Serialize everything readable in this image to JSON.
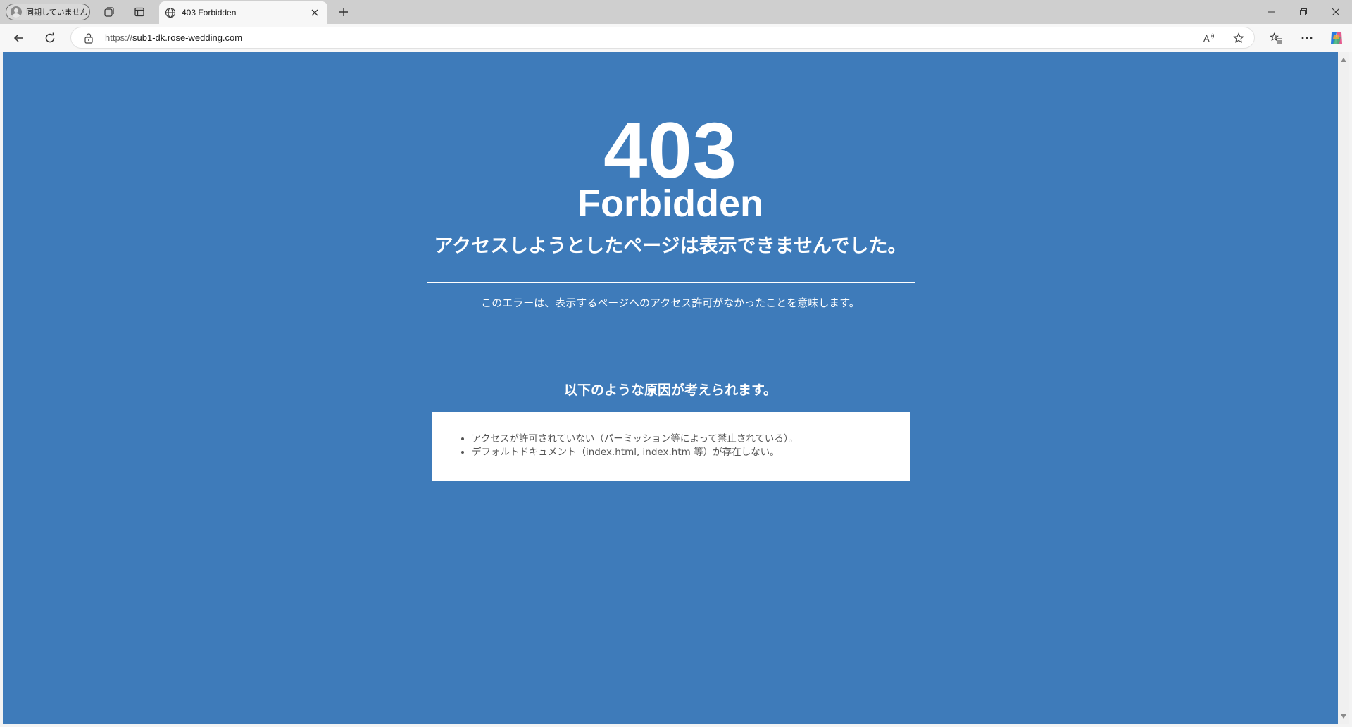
{
  "browser": {
    "profile_label": "同期していません",
    "tab_title": "403 Forbidden",
    "url_scheme": "https://",
    "url_host": "sub1-dk.rose-wedding.com"
  },
  "page": {
    "background_color": "#3e7bba",
    "code": "403",
    "status": "Forbidden",
    "headline": "アクセスしようとしたページは表示できませんでした。",
    "explanation": "このエラーは、表示するページへのアクセス許可がなかったことを意味します。",
    "causes_title": "以下のような原因が考えられます。",
    "causes": [
      "アクセスが許可されていない（パーミッション等によって禁止されている）。",
      "デフォルトドキュメント（index.html, index.htm 等）が存在しない。"
    ]
  },
  "icons": {
    "tabbar": [
      "avatar-icon",
      "collections-icon",
      "tab-actions-icon",
      "globe-icon",
      "close-icon",
      "new-tab-icon",
      "minimize-icon",
      "restore-icon",
      "window-close-icon"
    ],
    "navbar": [
      "back-icon",
      "refresh-icon",
      "lock-icon",
      "read-aloud-icon",
      "favorite-star-icon",
      "favorites-icon",
      "more-icon",
      "copilot-icon"
    ]
  }
}
